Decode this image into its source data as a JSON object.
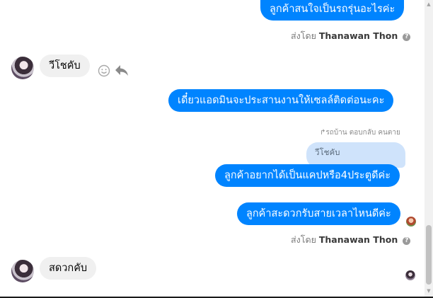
{
  "messages": {
    "out1": "ลูกค้าสนใจเป็นรถรุ่นอะไรค่ะ",
    "sent_by_1_prefix": "ส่งโดย",
    "sent_by_1_name": "Thanawan Thon",
    "in1": "วีโชคับ",
    "out2": "เดี๋ยวแอดมินจะประสานงานให้เซลล์ติดต่อนะคะ",
    "reply_meta": "รถบ้าน ตอบกลับ คนตาย",
    "reply_quote": "วีโชคับ",
    "out3": "ลูกค้าอยากได้เป็นแคปหรือ4ประตูดีค่ะ",
    "out4": "ลูกค้าสะดวกรับสายเวลาไหนดีค่ะ",
    "sent_by_2_prefix": "ส่งโดย",
    "sent_by_2_name": "Thanawan Thon",
    "in2": "สดวกคับ"
  },
  "icons": {
    "info": "info-circle-icon",
    "smile": "smile-icon",
    "reply": "reply-arrow-icon"
  },
  "colors": {
    "outgoing_bubble": "#0084ff",
    "incoming_bubble": "#f0f0f0",
    "reply_quote_bubble": "#cfe3fb"
  }
}
